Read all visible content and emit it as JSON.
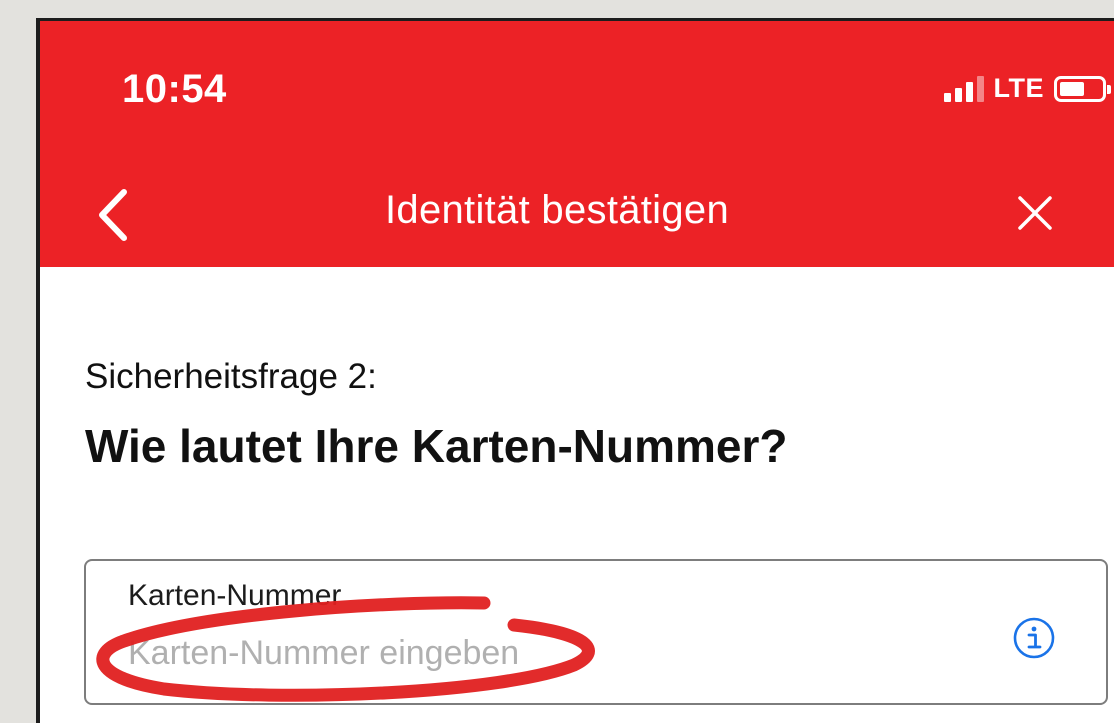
{
  "status_bar": {
    "time": "10:54",
    "network": "LTE",
    "signal_bars_active": 3,
    "signal_bars_total": 4,
    "battery_level": 0.6
  },
  "nav": {
    "title": "Identität bestätigen",
    "back_icon": "chevron-left-icon",
    "close_icon": "close-icon"
  },
  "content": {
    "question_number": "Sicherheitsfrage 2:",
    "question_text": "Wie lautet Ihre Karten-Nummer?",
    "input": {
      "label": "Karten-Nummer",
      "value": "",
      "placeholder": "Karten-Nummer eingeben",
      "info_icon": "info-icon"
    }
  },
  "colors": {
    "header_red": "#ec2226",
    "annotation_red": "#e02020",
    "info_blue": "#1a73e8",
    "background": "#ffffff",
    "outer_background": "#e3e2de"
  }
}
